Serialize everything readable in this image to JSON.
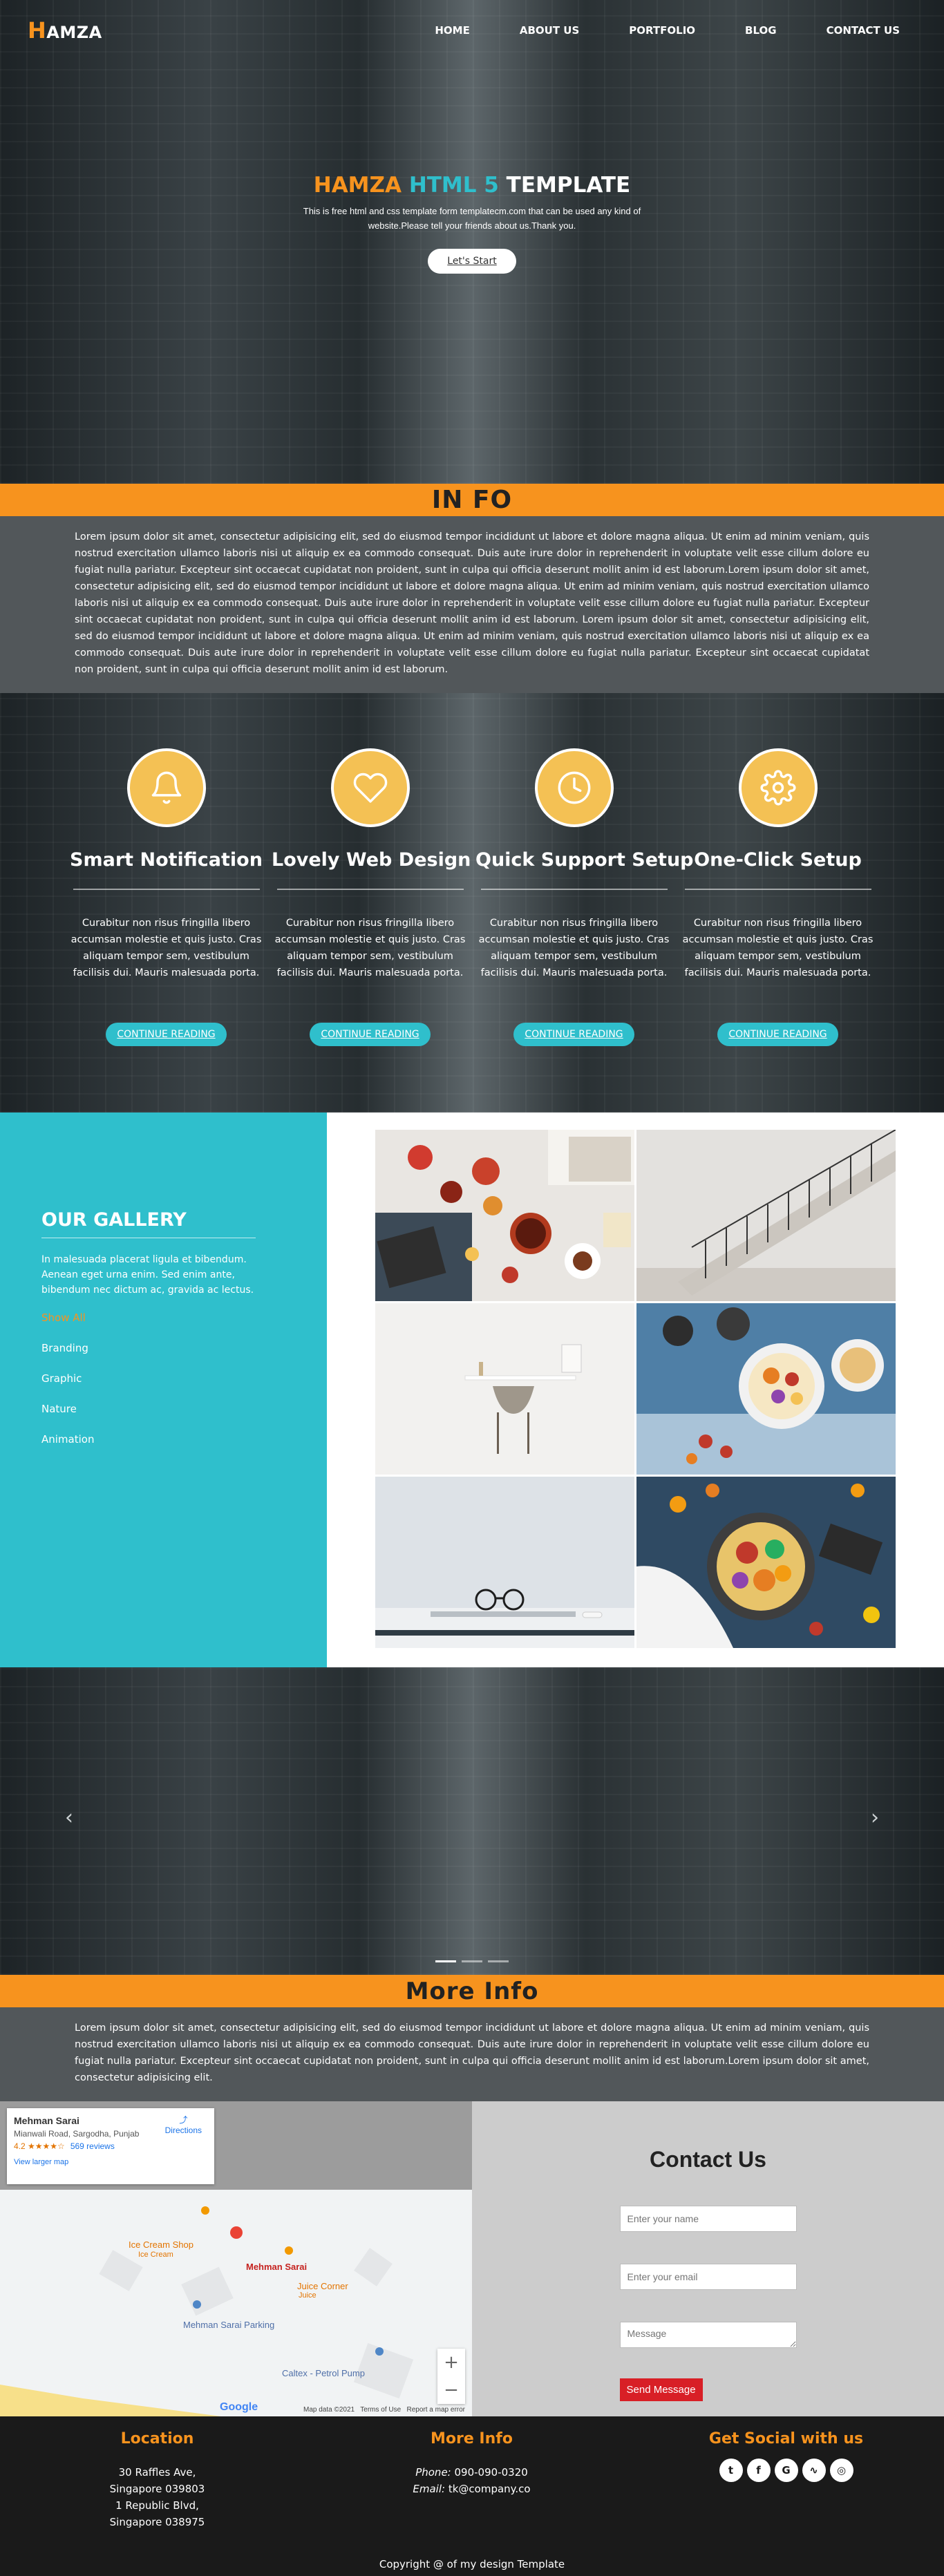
{
  "brand": {
    "first": "H",
    "rest": "AMZA"
  },
  "nav": [
    "HOME",
    "ABOUT US",
    "PORTFOLIO",
    "BLOG",
    "CONTACT US"
  ],
  "hero": {
    "title_1": "HAMZA",
    "title_2": "HTML 5",
    "title_3": "TEMPLATE",
    "subtitle": "This is free html and css template form templatecm.com that can be used any kind of website.Please tell your friends about us.Thank you.",
    "button": "Let's Start"
  },
  "info": {
    "title": "IN FO",
    "body": "Lorem ipsum dolor sit amet, consectetur adipisicing elit, sed do eiusmod tempor incididunt ut labore et dolore magna aliqua. Ut enim ad minim veniam, quis nostrud exercitation ullamco laboris nisi ut aliquip ex ea commodo consequat. Duis aute irure dolor in reprehenderit in voluptate velit esse cillum dolore eu fugiat nulla pariatur. Excepteur sint occaecat cupidatat non proident, sunt in culpa qui officia deserunt mollit anim id est laborum.Lorem ipsum dolor sit amet, consectetur adipisicing elit, sed do eiusmod tempor incididunt ut labore et dolore magna aliqua. Ut enim ad minim veniam, quis nostrud exercitation ullamco laboris nisi ut aliquip ex ea commodo consequat. Duis aute irure dolor in reprehenderit in voluptate velit esse cillum dolore eu fugiat nulla pariatur. Excepteur sint occaecat cupidatat non proident, sunt in culpa qui officia deserunt mollit anim id est laborum. Lorem ipsum dolor sit amet, consectetur adipisicing elit, sed do eiusmod tempor incididunt ut labore et dolore magna aliqua. Ut enim ad minim veniam, quis nostrud exercitation ullamco laboris nisi ut aliquip ex ea commodo consequat. Duis aute irure dolor in reprehenderit in voluptate velit esse cillum dolore eu fugiat nulla pariatur. Excepteur sint occaecat cupidatat non proident, sunt in culpa qui officia deserunt mollit anim id est laborum."
  },
  "features": [
    {
      "icon": "bell-icon",
      "title": "Smart Notification",
      "text": "Curabitur non risus fringilla libero accumsan molestie et quis justo. Cras aliquam tempor sem, vestibulum facilisis dui. Mauris malesuada porta.",
      "button": "CONTINUE READING"
    },
    {
      "icon": "heart-icon",
      "title": "Lovely Web Design",
      "text": "Curabitur non risus fringilla libero accumsan molestie et quis justo. Cras aliquam tempor sem, vestibulum facilisis dui. Mauris malesuada porta.",
      "button": "CONTINUE READING"
    },
    {
      "icon": "clock-icon",
      "title": "Quick Support Setup",
      "text": "Curabitur non risus fringilla libero accumsan molestie et quis justo. Cras aliquam tempor sem, vestibulum facilisis dui. Mauris malesuada porta.",
      "button": "CONTINUE READING"
    },
    {
      "icon": "gear-icon",
      "title": "One-Click Setup",
      "text": "Curabitur non risus fringilla libero accumsan molestie et quis justo. Cras aliquam tempor sem, vestibulum facilisis dui. Mauris malesuada porta.",
      "button": "CONTINUE READING"
    }
  ],
  "gallery": {
    "title": "OUR GALLERY",
    "text": "In malesuada placerat ligula et bibendum. Aenean eget urna enim. Sed enim ante, bibendum nec dictum ac, gravida ac lectus.",
    "filters": [
      "Show All",
      "Branding",
      "Graphic",
      "Nature",
      "Animation"
    ],
    "active_filter": "Show All"
  },
  "more_info": {
    "title": "More Info",
    "body": "Lorem ipsum dolor sit amet, consectetur adipisicing elit, sed do eiusmod tempor incididunt ut labore et dolore magna aliqua. Ut enim ad minim veniam, quis nostrud exercitation ullamco laboris nisi ut aliquip ex ea commodo consequat. Duis aute irure dolor in reprehenderit in voluptate velit esse cillum dolore eu fugiat nulla pariatur. Excepteur sint occaecat cupidatat non proident, sunt in culpa qui officia deserunt mollit anim id est laborum.Lorem ipsum dolor sit amet, consectetur adipisicing elit."
  },
  "map": {
    "place_name": "Mehman Sarai",
    "address": "Mianwali Road, Sargodha, Punjab",
    "rating": "4.2 ★★★★☆",
    "reviews": "569 reviews",
    "directions": "Directions",
    "larger_map": "View larger map",
    "labels": [
      "Ice Cream Shop",
      "Ice Cream",
      "Mehman Sarai",
      "Juice Corner",
      "Juice",
      "Mehman Sarai Parking",
      "Caltex - Petrol Pump"
    ],
    "footer_links": [
      "Map data ©2021",
      "Terms of Use",
      "Report a map error"
    ],
    "google": "Google"
  },
  "contact": {
    "title": "Contact Us",
    "name_placeholder": "Enter your name",
    "email_placeholder": "Enter your email",
    "message_placeholder": "Message",
    "button": "Send Message"
  },
  "footer": {
    "location_title": "Location",
    "location_lines": [
      "30 Raffles Ave,",
      "Singapore 039803",
      "1 Republic Blvd,",
      "Singapore 038975"
    ],
    "info_title": "More Info",
    "phone_label": "Phone:",
    "phone": "090-090-0320",
    "email_label": "Email:",
    "email": "tk@company.co",
    "social_title": "Get Social with us",
    "socials": [
      "twitter-icon",
      "facebook-icon",
      "google-plus-icon",
      "rss-icon",
      "dribbble-icon"
    ],
    "copyright": "Copyright @ of my design Template"
  },
  "colors": {
    "accent_orange": "#f7931e",
    "accent_teal": "#2fbfcc",
    "feature_yellow": "#f4c154",
    "send_red": "#d81f26"
  }
}
